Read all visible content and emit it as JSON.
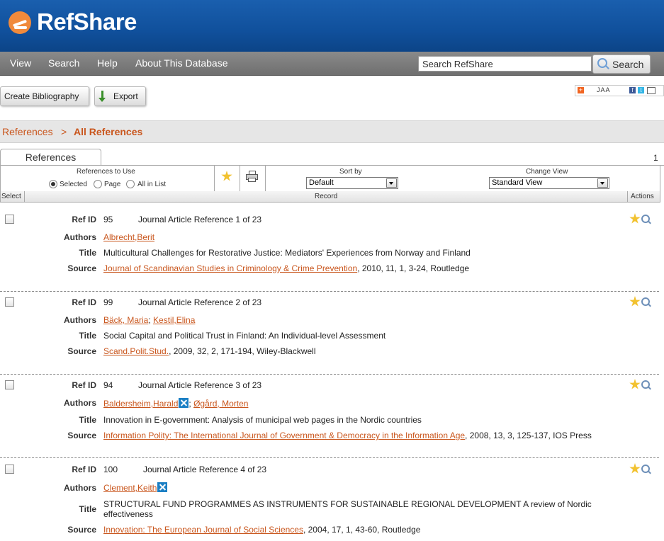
{
  "app": {
    "title": "RefShare"
  },
  "nav": {
    "items": [
      "View",
      "Search",
      "Help",
      "About This Database"
    ]
  },
  "search": {
    "placeholder": "Search RefShare",
    "value": "Search RefShare",
    "button": "Search"
  },
  "toolbar": {
    "create_bibliography": "Create Bibliography",
    "export": "Export"
  },
  "share": {
    "label": "JAA"
  },
  "breadcrumb": {
    "root": "References",
    "separator": ">",
    "current": "All References"
  },
  "tab": {
    "label": "References",
    "page": "1"
  },
  "controls": {
    "refs_to_use": "References to Use",
    "options": [
      "Selected",
      "Page",
      "All in List"
    ],
    "selected_option": "Selected",
    "sort_by_label": "Sort by",
    "sort_by_value": "Default",
    "change_view_label": "Change View",
    "change_view_value": "Standard View"
  },
  "table_header": {
    "select": "Select",
    "record": "Record",
    "actions": "Actions"
  },
  "field_labels": {
    "refid": "Ref ID",
    "authors": "Authors",
    "title": "Title",
    "source": "Source"
  },
  "records": [
    {
      "refid": "95",
      "type": "Journal Article Reference 1 of 23",
      "authors": [
        "Albrecht,Berit"
      ],
      "author_sep": [
        ""
      ],
      "title": "Multicultural Challenges for Restorative Justice: Mediators' Experiences from Norway and Finland",
      "source_link": "Journal of Scandinavian Studies in Criminology & Crime Prevention",
      "source_rest": ", 2010, 11, 1, 3-24, Routledge"
    },
    {
      "refid": "99",
      "type": "Journal Article Reference 2 of 23",
      "authors": [
        "Bäck, Maria",
        "Kestil,Elina"
      ],
      "author_sep": [
        "; "
      ],
      "title": "Social Capital and Political Trust in Finland: An Individual-level Assessment",
      "source_link": "Scand.Polit.Stud.",
      "source_rest": ", 2009, 32, 2, 171-194, Wiley-Blackwell"
    },
    {
      "refid": "94",
      "type": "Journal Article Reference 3 of 23",
      "authors": [
        "Baldersheim,Harald",
        "Øgård, Morten"
      ],
      "author_sep": [
        "; "
      ],
      "title": "Innovation in E-government: Analysis of municipal web pages in the Nordic countries",
      "source_link": "Information Polity: The International Journal of Government & Democracy in the Information Age",
      "source_rest": ", 2008, 13, 3, 125-137, IOS Press"
    },
    {
      "refid": "100",
      "type": "Journal Article Reference 4 of 23",
      "authors": [
        "Clement,Keith"
      ],
      "author_sep": [
        ""
      ],
      "title": "STRUCTURAL FUND PROGRAMMES AS INSTRUMENTS FOR SUSTAINABLE REGIONAL DEVELOPMENT A review of Nordic effectiveness",
      "source_link": "Innovation: The European Journal of Social Sciences",
      "source_rest": ", 2004, 17, 1, 43-60, Routledge"
    }
  ]
}
